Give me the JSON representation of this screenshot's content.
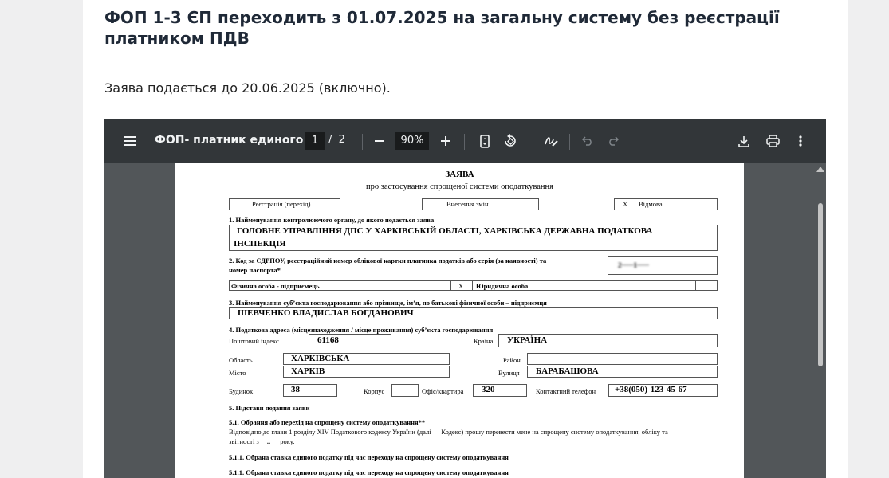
{
  "article": {
    "heading": "ФОП 1-3 ЄП переходить з 01.07.2025 на загальну систему без реєстрації платником ПДВ",
    "lead": "Заява подається до 20.06.2025 (включно)."
  },
  "viewer": {
    "title": "ФОП- платник единого ...",
    "current_page": "1",
    "page_separator": "/",
    "total_pages": "2",
    "zoom": "90%",
    "icons": [
      "menu-icon",
      "zoom-out-icon",
      "zoom-in-icon",
      "fit-page-icon",
      "rotate-icon",
      "annotate-icon",
      "undo-icon",
      "redo-icon",
      "download-icon",
      "print-icon",
      "more-icon"
    ],
    "colors": {
      "toolbar": "#323639",
      "background": "#525659"
    }
  },
  "form": {
    "title": "ЗАЯВА",
    "subtitle": "про застосування спрощеної системи оподаткування",
    "options": {
      "registration": "Реєстрація (перехід)",
      "changes": "Внесення змін",
      "refusal_mark": "Х",
      "refusal": "Відмова"
    },
    "s1_label": "1. Найменування контролюючого органу, до якого подається заява",
    "s1_value_line1": "ГОЛОВНЕ УПРАВЛІННЯ ДПС У ХАРКІВСЬКІЙ ОБЛАСТІ, ХАРКІВСЬКА ДЕРЖАВНА ПОДАТКОВА",
    "s1_value_line2": "ІНСПЕКЦІЯ",
    "s2_label_line1": "2. Код за ЄДРПОУ, реєстраційний номер облікової картки платника податків або серія (за наявності) та",
    "s2_label_line2": "номер паспорта*",
    "s2_value_blurred": "2·····1·····",
    "person_type": {
      "individual": "Фізична особа - підприємець",
      "mark": "Х",
      "legal": "Юридична особа"
    },
    "s3_label": "3. Найменування суб’єкта господарювання або прізвище, ім’я, по батькові фізичної особи – підприємця",
    "s3_value": "ШЕВЧЕНКО ВЛАДИСЛАВ БОГДАНОВИЧ",
    "s4_label": "4. Податкова адреса (місцезнаходження / місце проживання) суб’єкта господарювання",
    "postal_label": "Поштовий індекс",
    "postal_value": "61168",
    "country_label": "Країна",
    "country_value": "УКРАЇНА",
    "region_label": "Область",
    "region_value": "ХАРКІВСЬКА",
    "district_label": "Район",
    "city_label": "Місто",
    "city_value": "ХАРКІВ",
    "street_label": "Вулиця",
    "street_value": "БАРАБАШОВА",
    "building_label": "Будинок",
    "building_value": "38",
    "block_label": "Корпус",
    "office_label": "Офіс/квартира",
    "office_value": "320",
    "phone_label": "Контактний телефон",
    "phone_value": "+38(050)-123-45-67",
    "s5_label": "5. Підстави подання заяви",
    "s51_label": "5.1. Обрання або перехід на спрощену систему оподаткування**",
    "s51_text_line1": "Відповідно до глави 1 розділу XIV Податкового кодексу України (далі — Кодекс) прошу перевести мене на спрощену систему оподаткування, обліку та",
    "s51_text_line2": "звітності з",
    "s51_dots": "..",
    "s51_year": "року.",
    "s511_label": "5.1.1. Обрана ставка єдиного податку під час переходу на спрощену систему оподаткування",
    "s511_label_repeat": "5.1.1. Обрана ставка єдиного податку під час переходу на спрощену систему оподаткування"
  }
}
